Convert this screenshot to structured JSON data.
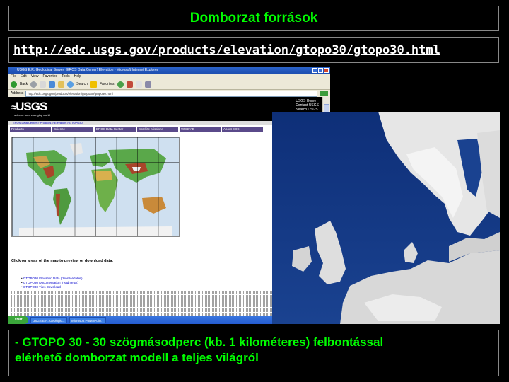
{
  "slide": {
    "title": "Domborzat források",
    "url": "http://edc.usgs.gov/products/elevation/gtopo30/gtopo30.html",
    "caption_line1": "- GTOPO 30 - 30 szögmásodperc (kb. 1 kilométeres) felbontással",
    "caption_line2": "elérhető domborzat modell a teljes világról"
  },
  "browser": {
    "window_title": "USGS E.R. Geological Survey (EROS Data Center) Elevation - Microsoft Internet Explorer",
    "menu": [
      "File",
      "Edit",
      "View",
      "Favorites",
      "Tools",
      "Help"
    ],
    "toolbar": {
      "back_label": "Back",
      "search_label": "Search",
      "favorites_label": "Favorites"
    },
    "address_label": "Address",
    "address_value": "http://edc.usgs.gov/products/elevation/gtopo30/gtopo30.html",
    "taskbar": {
      "start_label": "start",
      "task1": "USGS E.R. Geologic...",
      "task2": "Microsoft PowerPoint",
      "clock": ""
    }
  },
  "usgs_page": {
    "logo": "USGS",
    "tagline": "science for a changing world",
    "right_links": [
      "USGS Home",
      "Contact USGS",
      "Search USGS"
    ],
    "crumb": "EROS Data Center > Products > Elevation > GTOPO30",
    "nav_tabs": [
      "Products",
      "Science",
      "EROS Data Center",
      "Satellite Missions",
      "WEBFAB",
      "About EDC"
    ],
    "map_caption": "Click on areas of the map to preview or download data.",
    "links": [
      "GTOPO30 Elevation Data (downloadable)",
      "GTOPO30 Documentation (readme.txt)",
      "GTOPO30 Tiles Download"
    ]
  },
  "colors": {
    "title_green": "#00ff00",
    "background": "#000000",
    "url_white": "#ffffff"
  }
}
